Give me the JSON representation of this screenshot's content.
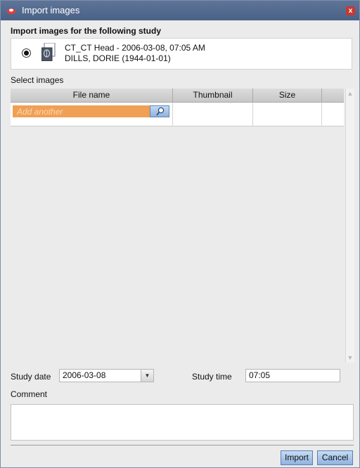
{
  "window": {
    "title": "Import images",
    "close_glyph": "x"
  },
  "study": {
    "heading": "Import images for the following study",
    "line1": "CT_CT Head - 2006-03-08, 07:05 AM",
    "line2": "DILLS, DORIE (1944-01-01)",
    "icon": "ct-study-icon"
  },
  "images": {
    "label": "Select images",
    "columns": [
      "File name",
      "Thumbnail",
      "Size",
      ""
    ],
    "add_placeholder": "Add another",
    "search_icon": "magnifier-icon"
  },
  "scrollbar": {
    "up": "▲",
    "down": "▼"
  },
  "form": {
    "study_date_label": "Study date",
    "study_date_value": "2006-03-08",
    "study_time_label": "Study time",
    "study_time_value": "07:05",
    "comment_label": "Comment",
    "comment_value": "",
    "dropdown_glyph": "▼"
  },
  "buttons": {
    "import": "Import",
    "cancel": "Cancel"
  },
  "colors": {
    "titlebar": "#4a6186",
    "input_highlight": "#f0a055",
    "button": "#8fb3df"
  }
}
